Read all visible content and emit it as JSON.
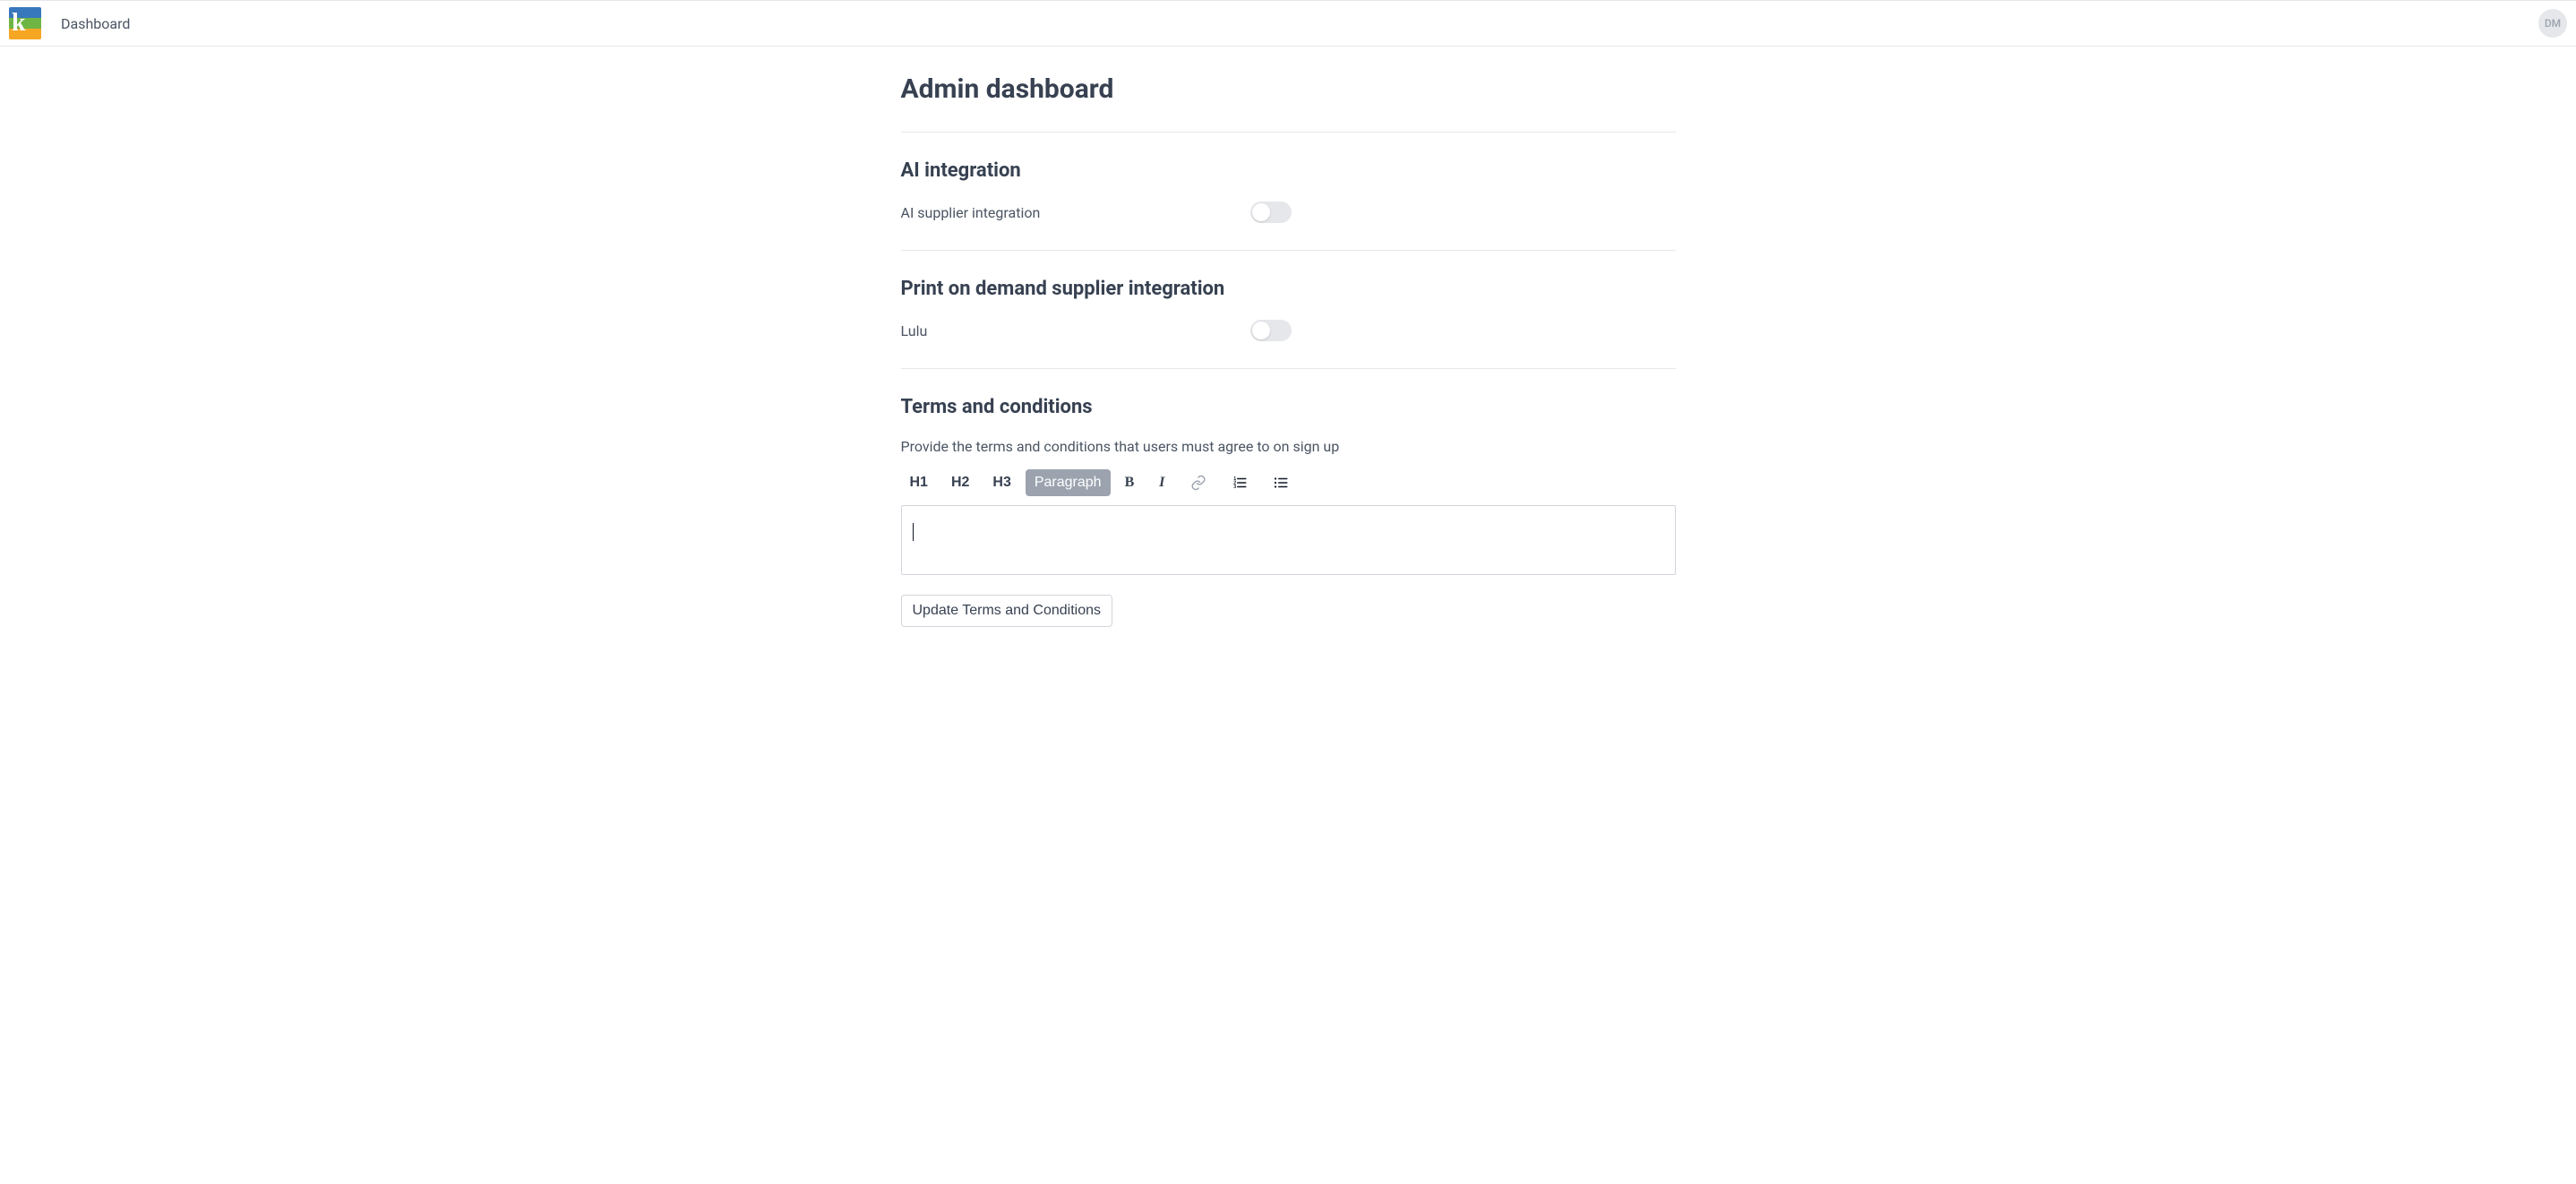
{
  "header": {
    "breadcrumb": "Dashboard",
    "avatar_initials": "DM"
  },
  "page": {
    "title": "Admin dashboard"
  },
  "sections": {
    "ai": {
      "title": "AI integration",
      "toggles": [
        {
          "label": "AI supplier integration",
          "value": false
        }
      ]
    },
    "pod": {
      "title": "Print on demand supplier integration",
      "toggles": [
        {
          "label": "Lulu",
          "value": false
        }
      ]
    },
    "terms": {
      "title": "Terms and conditions",
      "description": "Provide the terms and conditions that users must agree to on sign up",
      "toolbar": {
        "h1": "H1",
        "h2": "H2",
        "h3": "H3",
        "paragraph": "Paragraph",
        "bold": "B",
        "italic": "I"
      },
      "content": "",
      "update_button": "Update Terms and Conditions"
    }
  }
}
